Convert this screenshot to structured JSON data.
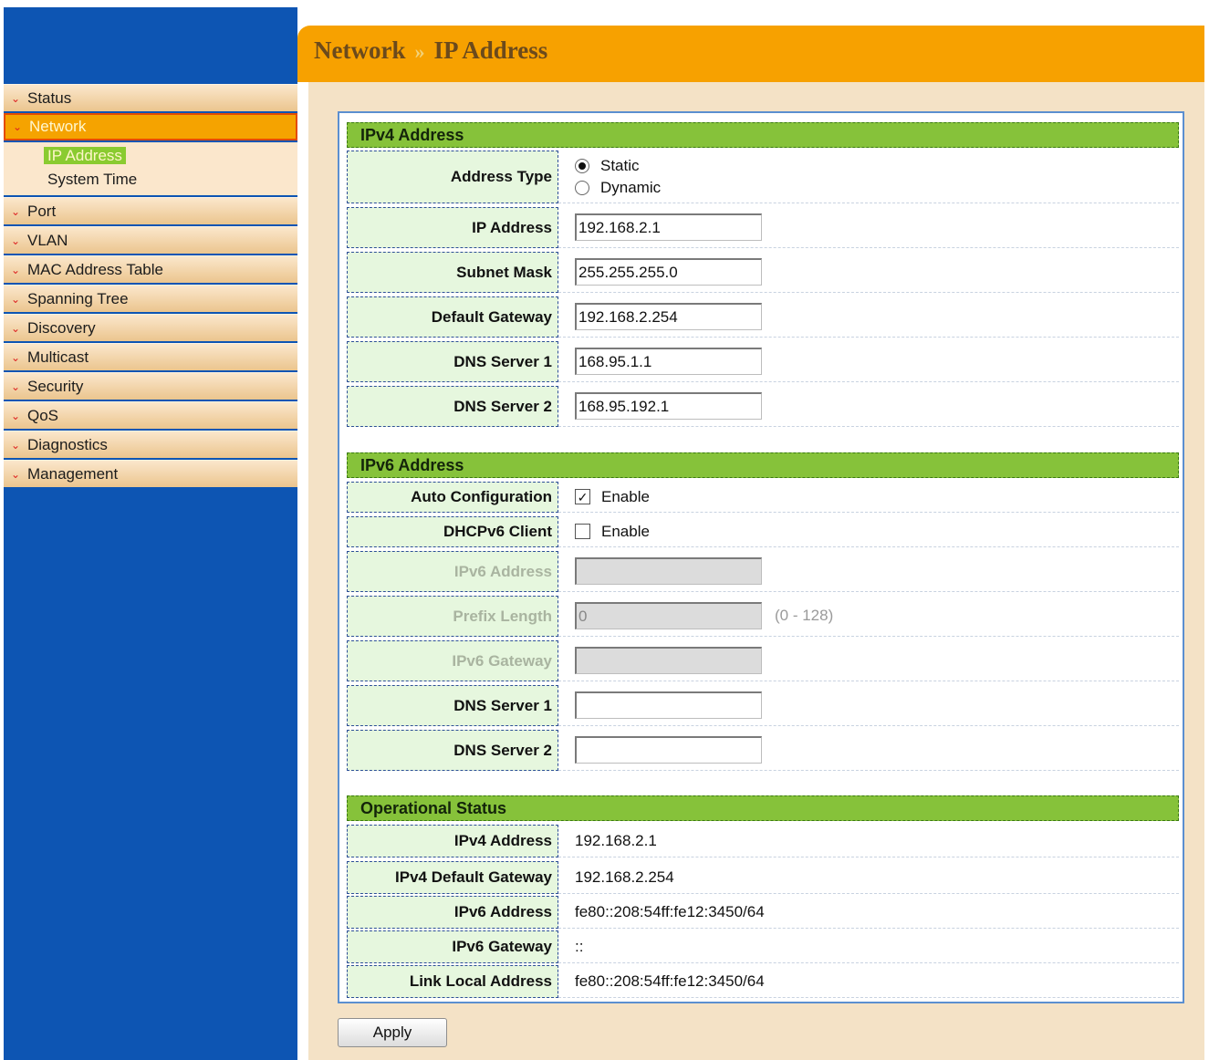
{
  "breadcrumb": {
    "section": "Network",
    "separator": "»",
    "page": "IP Address"
  },
  "menu": {
    "items": [
      {
        "label": "Status"
      },
      {
        "label": "Network"
      },
      {
        "label": "Port"
      },
      {
        "label": "VLAN"
      },
      {
        "label": "MAC Address Table"
      },
      {
        "label": "Spanning Tree"
      },
      {
        "label": "Discovery"
      },
      {
        "label": "Multicast"
      },
      {
        "label": "Security"
      },
      {
        "label": "QoS"
      },
      {
        "label": "Diagnostics"
      },
      {
        "label": "Management"
      }
    ],
    "network_sub": [
      {
        "label": "IP Address"
      },
      {
        "label": "System Time"
      }
    ]
  },
  "ipv4": {
    "heading": "IPv4 Address",
    "address_type_label": "Address Type",
    "opt_static": "Static",
    "opt_dynamic": "Dynamic",
    "ip_label": "IP Address",
    "ip_value": "192.168.2.1",
    "mask_label": "Subnet Mask",
    "mask_value": "255.255.255.0",
    "gw_label": "Default Gateway",
    "gw_value": "192.168.2.254",
    "dns1_label": "DNS Server 1",
    "dns1_value": "168.95.1.1",
    "dns2_label": "DNS Server 2",
    "dns2_value": "168.95.192.1"
  },
  "ipv6": {
    "heading": "IPv6 Address",
    "auto_label": "Auto Configuration",
    "auto_enable": "Enable",
    "dhcp_label": "DHCPv6 Client",
    "dhcp_enable": "Enable",
    "addr_label": "IPv6 Address",
    "addr_value": "",
    "prefix_label": "Prefix Length",
    "prefix_value": "0",
    "prefix_range": "(0 - 128)",
    "gw_label": "IPv6 Gateway",
    "gw_value": "",
    "dns1_label": "DNS Server 1",
    "dns1_value": "",
    "dns2_label": "DNS Server 2",
    "dns2_value": ""
  },
  "status": {
    "heading": "Operational Status",
    "rows": [
      {
        "label": "IPv4 Address",
        "value": "192.168.2.1"
      },
      {
        "label": "IPv4 Default Gateway",
        "value": "192.168.2.254"
      },
      {
        "label": "IPv6 Address",
        "value": "fe80::208:54ff:fe12:3450/64"
      },
      {
        "label": "IPv6 Gateway",
        "value": "::"
      },
      {
        "label": "Link Local Address",
        "value": "fe80::208:54ff:fe12:3450/64"
      }
    ]
  },
  "apply_label": "Apply"
}
